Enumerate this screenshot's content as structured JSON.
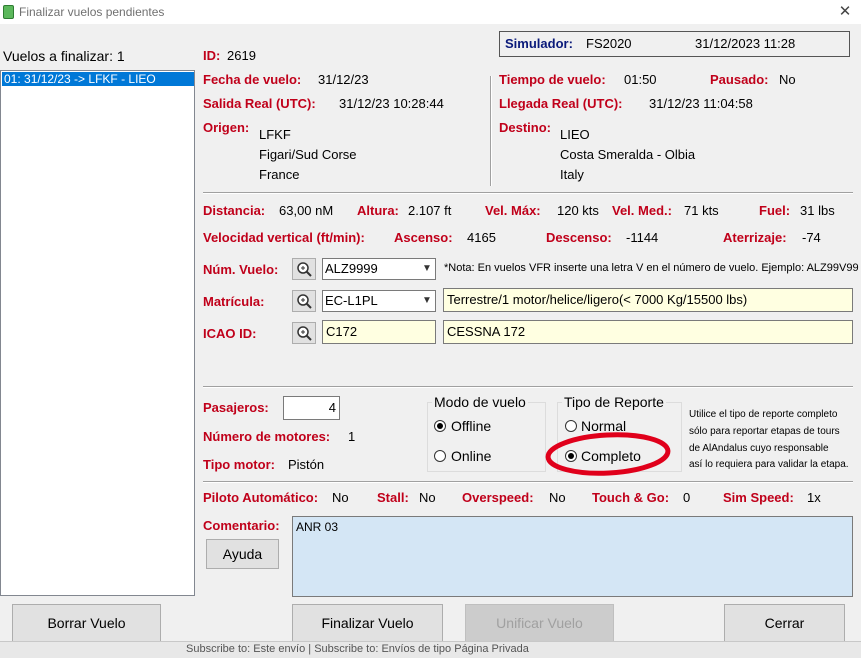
{
  "window": {
    "title": "Finalizar vuelos pendientes",
    "close_glyph": "✕"
  },
  "sidebar": {
    "header": "Vuelos a finalizar: 1",
    "items": [
      "01: 31/12/23 -> LFKF - LIEO"
    ]
  },
  "simulator": {
    "label": "Simulador:",
    "value": "FS2020",
    "datetime": "31/12/2023 11:28"
  },
  "flight": {
    "id_label": "ID:",
    "id": "2619",
    "date_label": "Fecha de vuelo:",
    "date": "31/12/23",
    "departure_label": "Salida Real (UTC):",
    "departure": "31/12/23 10:28:44",
    "origin_label": "Origen:",
    "origin": [
      "LFKF",
      "Figari/Sud Corse",
      "France"
    ],
    "time_label": "Tiempo de vuelo:",
    "time": "01:50",
    "paused_label": "Pausado:",
    "paused": "No",
    "arrival_label": "Llegada Real (UTC):",
    "arrival": "31/12/23 11:04:58",
    "destination_label": "Destino:",
    "destination": [
      "LIEO",
      "Costa Smeralda - Olbia",
      "Italy"
    ]
  },
  "stats": {
    "distance_label": "Distancia:",
    "distance": "63,00 nM",
    "altitude_label": "Altura:",
    "altitude": "2.107 ft",
    "vmax_label": "Vel. Máx:",
    "vmax": "120 kts",
    "vmed_label": "Vel. Med.:",
    "vmed": "71 kts",
    "fuel_label": "Fuel:",
    "fuel": "31 lbs",
    "vs_label": "Velocidad vertical (ft/min):",
    "ascent_label": "Ascenso:",
    "ascent": "4165",
    "descent_label": "Descenso:",
    "descent": "-1144",
    "landing_label": "Aterrizaje:",
    "landing": "-74"
  },
  "aircraft": {
    "flightnum_label": "Núm. Vuelo:",
    "flightnum": "ALZ9999",
    "note": "*Nota: En vuelos VFR inserte una letra V en el número de vuelo. Ejemplo: ALZ99V99",
    "reg_label": "Matrícula:",
    "reg": "EC-L1PL",
    "type_desc": "Terrestre/1 motor/helice/ligero(< 7000 Kg/15500 lbs)",
    "icao_label": "ICAO ID:",
    "icao": "C172",
    "icao_name": "CESSNA 172"
  },
  "details": {
    "pax_label": "Pasajeros:",
    "pax": "4",
    "engines_label": "Número de motores:",
    "engines": "1",
    "engine_type_label": "Tipo motor:",
    "engine_type": "Pistón"
  },
  "flight_mode": {
    "title": "Modo de vuelo",
    "options": [
      "Offline",
      "Online"
    ],
    "selected": "Offline"
  },
  "report_type": {
    "title": "Tipo de Reporte",
    "options": [
      "Normal",
      "Completo"
    ],
    "selected": "Completo",
    "help": [
      "Utilice el tipo de reporte completo",
      "sólo para reportar etapas de tours",
      "de AlAndalus cuyo responsable",
      "así lo requiera para validar la etapa."
    ],
    "highlight_color": "#e0001b"
  },
  "flags": {
    "autopilot_label": "Piloto Automático:",
    "autopilot": "No",
    "stall_label": "Stall:",
    "stall": "No",
    "overspeed_label": "Overspeed:",
    "overspeed": "No",
    "touchgo_label": "Touch & Go:",
    "touchgo": "0",
    "simspeed_label": "Sim Speed:",
    "simspeed": "1x"
  },
  "comment": {
    "label": "Comentario:",
    "value": "ANR 03",
    "help_button": "Ayuda"
  },
  "buttons": {
    "delete": "Borrar Vuelo",
    "finalize": "Finalizar Vuelo",
    "unify": "Unificar Vuelo",
    "close": "Cerrar"
  },
  "taskbar": {
    "text": "Subscribe to: Este envío  |  Subscribe to: Envíos de tipo Página Privada"
  }
}
